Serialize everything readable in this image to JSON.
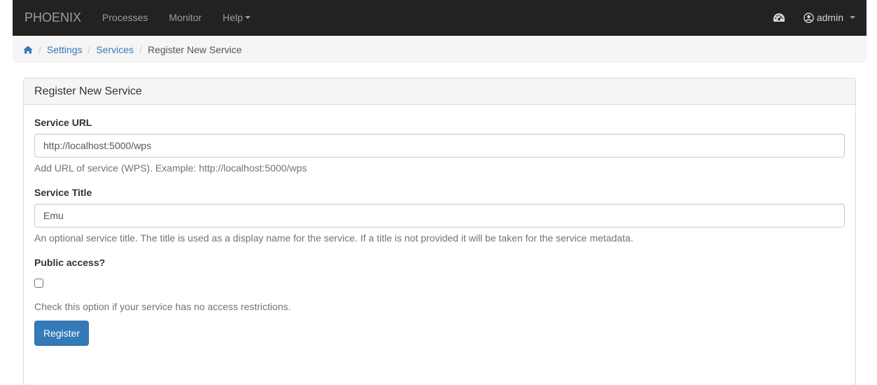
{
  "navbar": {
    "brand": "PHOENIX",
    "items": [
      {
        "label": "Processes"
      },
      {
        "label": "Monitor"
      },
      {
        "label": "Help"
      }
    ],
    "user": "admin",
    "icons": {
      "dashboard": "dashboard-icon",
      "user": "user-circle-icon",
      "home": "home-icon"
    }
  },
  "breadcrumb": {
    "items": [
      {
        "label": "Settings"
      },
      {
        "label": "Services"
      }
    ],
    "active": "Register New Service"
  },
  "panel": {
    "heading": "Register New Service",
    "service_url": {
      "label": "Service URL",
      "value": "http://localhost:5000/wps",
      "help": "Add URL of service (WPS). Example: http://localhost:5000/wps"
    },
    "service_title": {
      "label": "Service Title",
      "value": "Emu",
      "help": "An optional service title. The title is used as a display name for the service. If a title is not provided it will be taken for the service metadata."
    },
    "public_access": {
      "label": "Public access?",
      "checked": false,
      "help": "Check this option if your service has no access restrictions."
    },
    "submit_label": "Register"
  },
  "colors": {
    "navbar_bg": "#222222",
    "link": "#337ab7",
    "primary": "#337ab7"
  }
}
